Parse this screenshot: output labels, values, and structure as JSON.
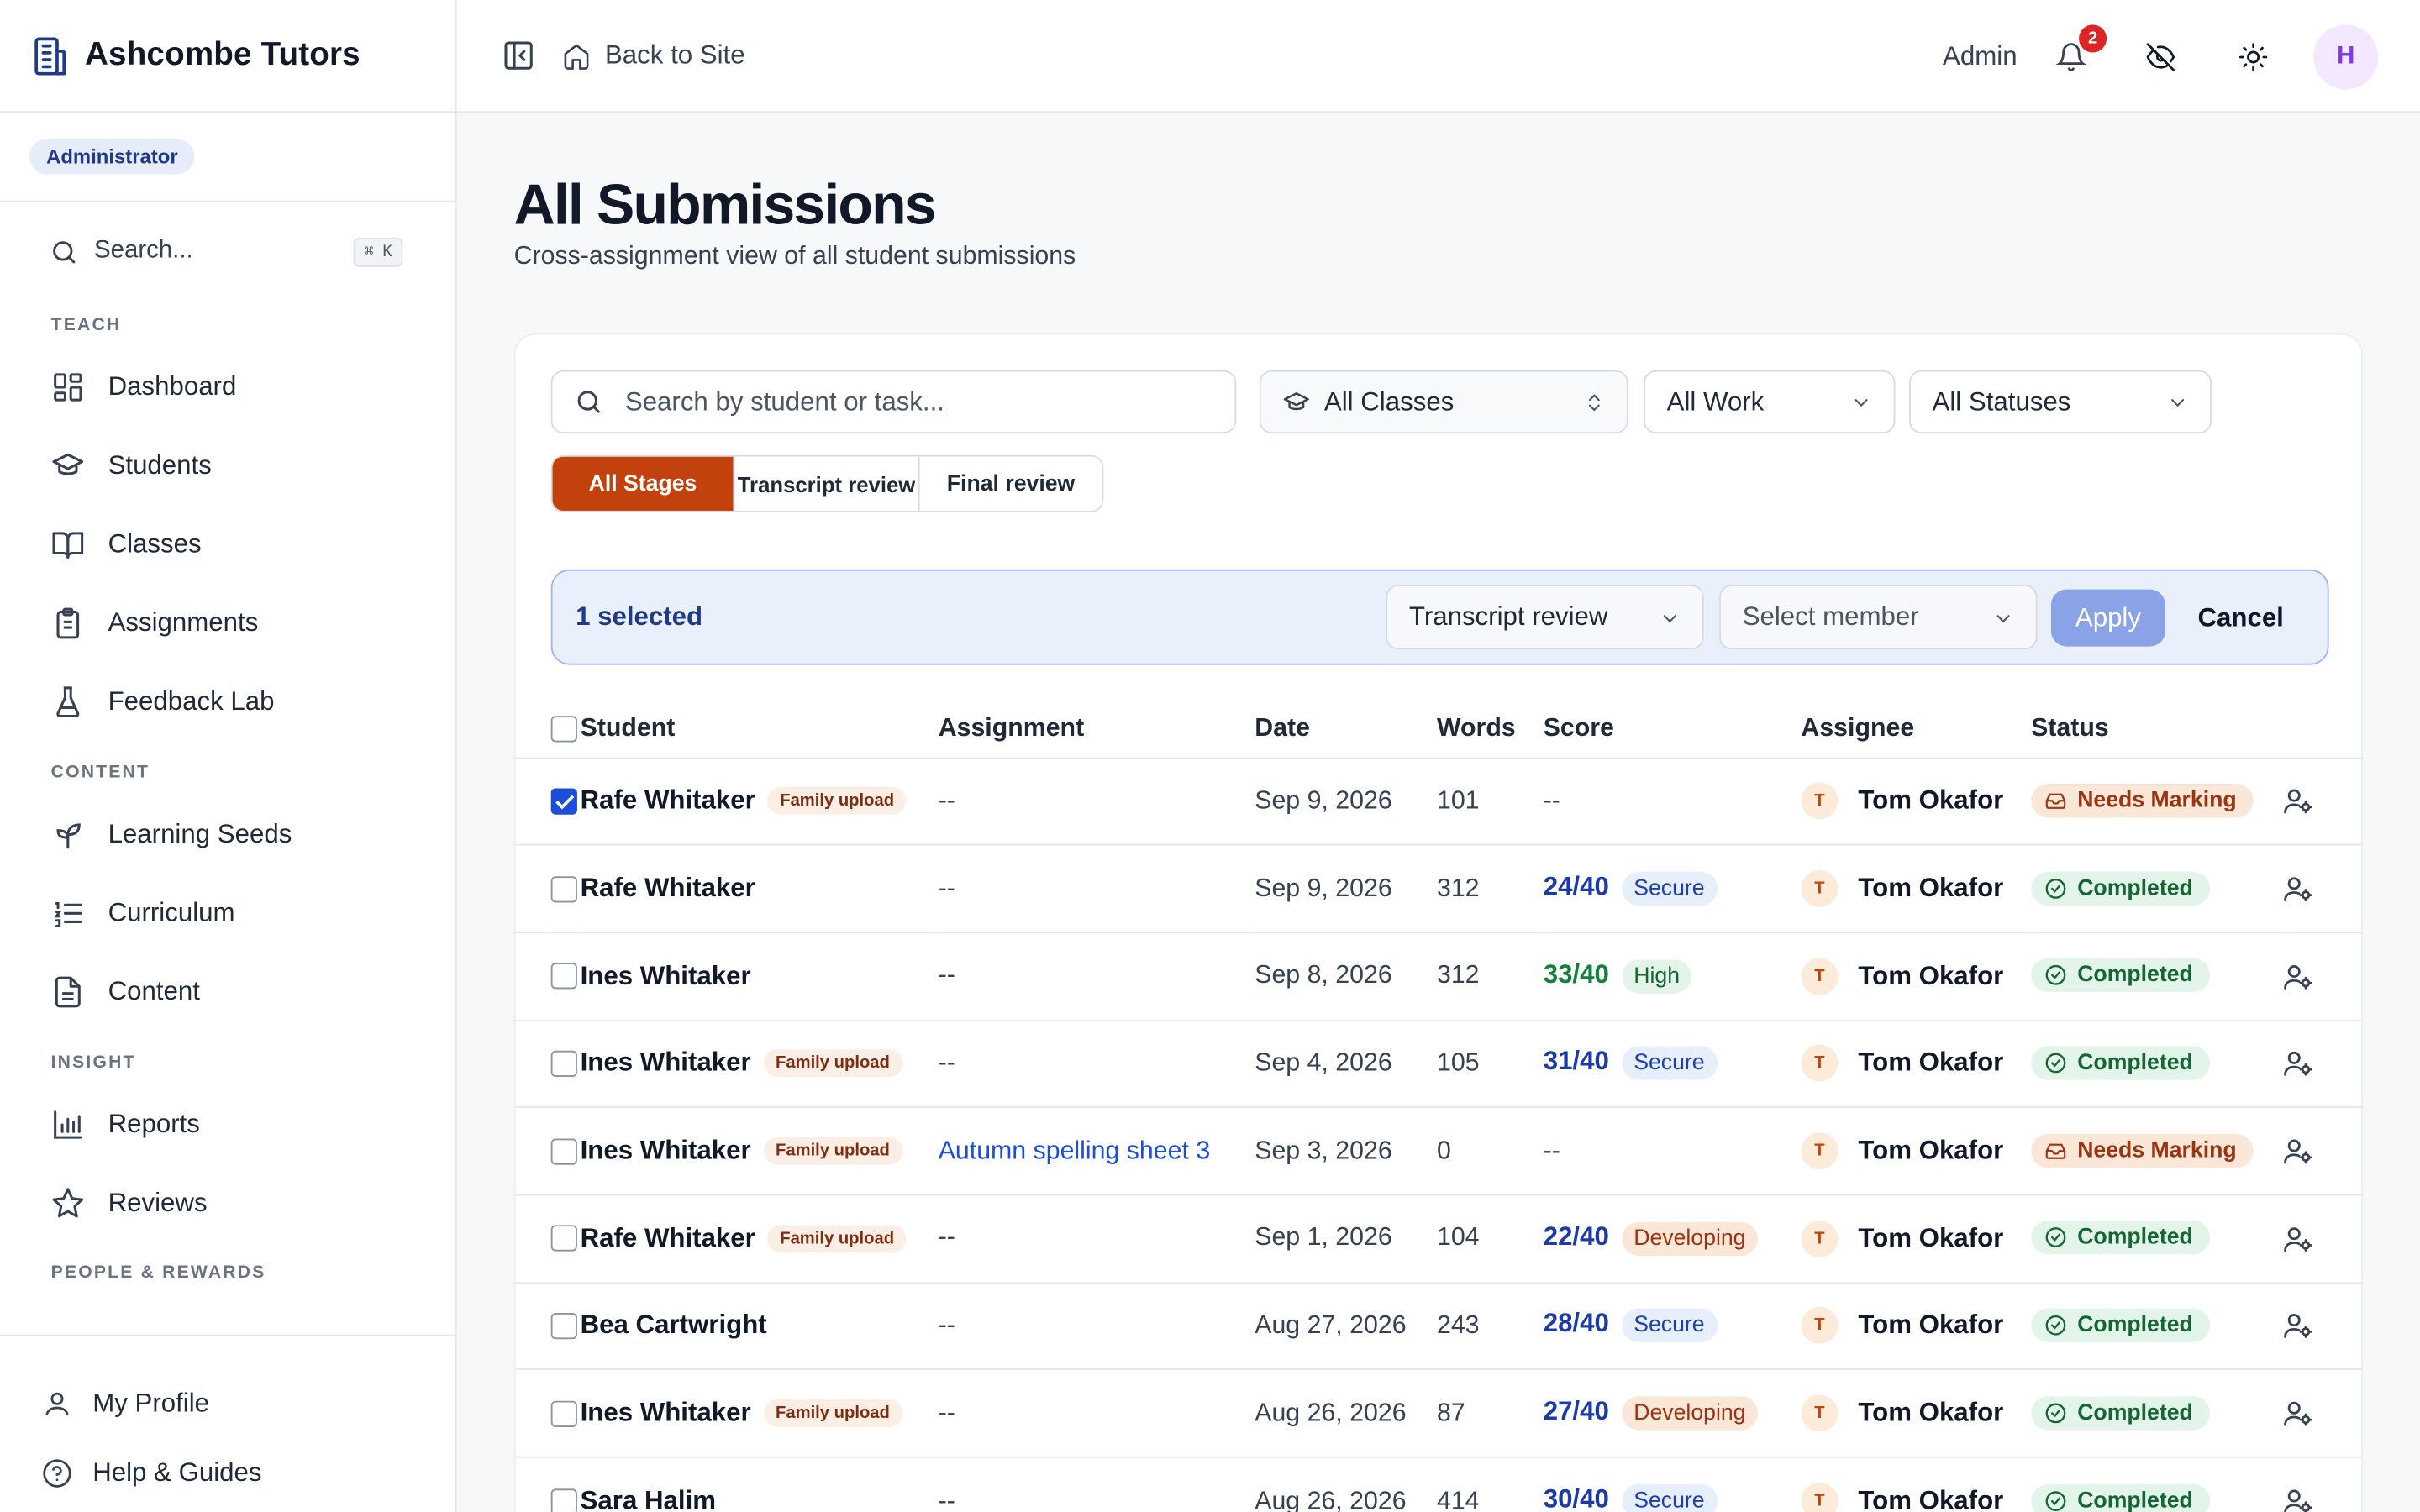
{
  "brand": {
    "name": "Ashcombe Tutors"
  },
  "role_badge": "Administrator",
  "sidebar": {
    "search_label": "Search...",
    "search_shortcut": "⌘ K",
    "sections": {
      "teach": "TEACH",
      "content": "CONTENT",
      "insight": "INSIGHT",
      "people": "PEOPLE & REWARDS"
    },
    "items": {
      "dashboard": "Dashboard",
      "students": "Students",
      "classes": "Classes",
      "assignments": "Assignments",
      "feedback_lab": "Feedback Lab",
      "learning_seeds": "Learning Seeds",
      "curriculum": "Curriculum",
      "content": "Content",
      "reports": "Reports",
      "reviews": "Reviews"
    },
    "bottom": {
      "profile": "My Profile",
      "help": "Help & Guides"
    }
  },
  "topbar": {
    "back": "Back to Site",
    "admin": "Admin",
    "notification_count": "2",
    "avatar_initial": "H"
  },
  "page": {
    "title": "All Submissions",
    "subtitle": "Cross-assignment view of all student submissions"
  },
  "filters": {
    "search_placeholder": "Search by student or task...",
    "classes": "All Classes",
    "work": "All Work",
    "statuses": "All Statuses",
    "stages": [
      "All Stages",
      "Transcript review",
      "Final review"
    ],
    "active_stage": "All Stages"
  },
  "bulk": {
    "selected": "1 selected",
    "stage_select": "Transcript review",
    "member_placeholder": "Select member",
    "apply": "Apply",
    "cancel": "Cancel"
  },
  "table": {
    "headers": [
      "Student",
      "Assignment",
      "Date",
      "Words",
      "Score",
      "Assignee",
      "Status"
    ],
    "rows": [
      {
        "checked": true,
        "student": "Rafe Whitaker",
        "badge": "Family upload",
        "assignment": "--",
        "date": "Sep 9, 2026",
        "words": "101",
        "score": "--",
        "band": "",
        "assignee_initial": "T",
        "assignee": "Tom Okafor",
        "status": "Needs Marking"
      },
      {
        "checked": false,
        "student": "Rafe Whitaker",
        "badge": "",
        "assignment": "--",
        "date": "Sep 9, 2026",
        "words": "312",
        "score": "24/40",
        "band": "Secure",
        "assignee_initial": "T",
        "assignee": "Tom Okafor",
        "status": "Completed"
      },
      {
        "checked": false,
        "student": "Ines Whitaker",
        "badge": "",
        "assignment": "--",
        "date": "Sep 8, 2026",
        "words": "312",
        "score": "33/40",
        "band": "High",
        "assignee_initial": "T",
        "assignee": "Tom Okafor",
        "status": "Completed"
      },
      {
        "checked": false,
        "student": "Ines Whitaker",
        "badge": "Family upload",
        "assignment": "--",
        "date": "Sep 4, 2026",
        "words": "105",
        "score": "31/40",
        "band": "Secure",
        "assignee_initial": "T",
        "assignee": "Tom Okafor",
        "status": "Completed"
      },
      {
        "checked": false,
        "student": "Ines Whitaker",
        "badge": "Family upload",
        "assignment": "Autumn spelling sheet 3",
        "date": "Sep 3, 2026",
        "words": "0",
        "score": "--",
        "band": "",
        "assignee_initial": "T",
        "assignee": "Tom Okafor",
        "status": "Needs Marking"
      },
      {
        "checked": false,
        "student": "Rafe Whitaker",
        "badge": "Family upload",
        "assignment": "--",
        "date": "Sep 1, 2026",
        "words": "104",
        "score": "22/40",
        "band": "Developing",
        "assignee_initial": "T",
        "assignee": "Tom Okafor",
        "status": "Completed"
      },
      {
        "checked": false,
        "student": "Bea Cartwright",
        "badge": "",
        "assignment": "--",
        "date": "Aug 27, 2026",
        "words": "243",
        "score": "28/40",
        "band": "Secure",
        "assignee_initial": "T",
        "assignee": "Tom Okafor",
        "status": "Completed"
      },
      {
        "checked": false,
        "student": "Ines Whitaker",
        "badge": "Family upload",
        "assignment": "--",
        "date": "Aug 26, 2026",
        "words": "87",
        "score": "27/40",
        "band": "Developing",
        "assignee_initial": "T",
        "assignee": "Tom Okafor",
        "status": "Completed"
      },
      {
        "checked": false,
        "student": "Sara Halim",
        "badge": "",
        "assignment": "--",
        "date": "Aug 26, 2026",
        "words": "414",
        "score": "30/40",
        "band": "Secure",
        "assignee_initial": "T",
        "assignee": "Tom Okafor",
        "status": "Completed"
      }
    ]
  },
  "colors": {
    "accent_orange": "#c2410c",
    "link_blue": "#1d4ed8",
    "score_blue": "#1e3aa8",
    "score_green": "#15803d"
  }
}
